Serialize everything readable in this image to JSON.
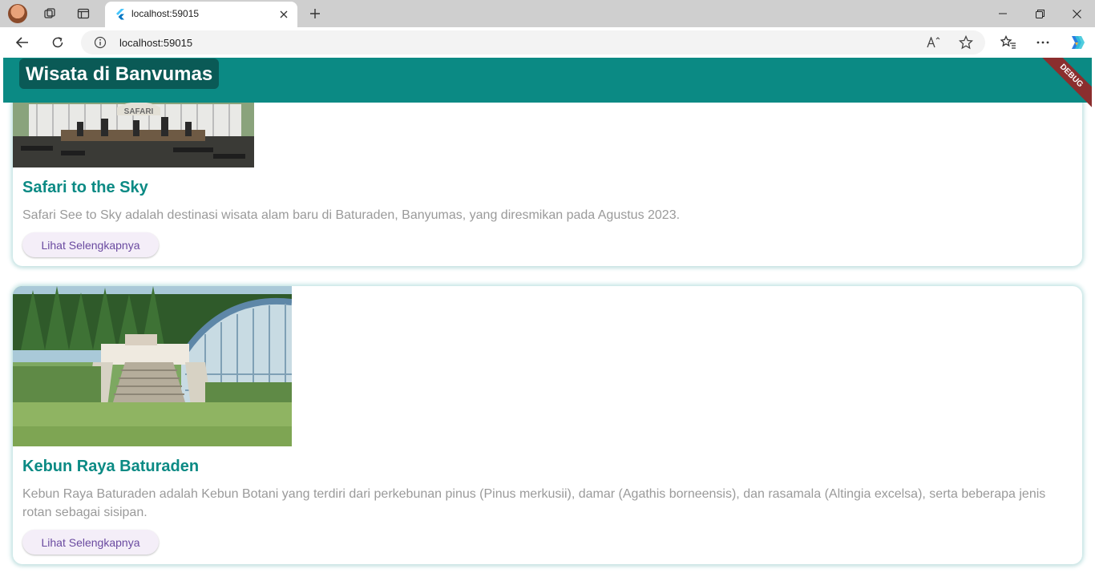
{
  "browser": {
    "tab_title": "localhost:59015",
    "address": "localhost:59015"
  },
  "app": {
    "title": "Wisata di Banvumas",
    "debug_banner": "DEBUG"
  },
  "destinations": [
    {
      "name": "Safari to the Sky",
      "description": "Safari See to Sky adalah destinasi wisata alam baru di Baturaden, Banyumas, yang diresmikan pada Agustus 2023.",
      "button_label": "Lihat Selengkapnya",
      "image_sign": "SAFARI"
    },
    {
      "name": "Kebun Raya Baturaden",
      "description": "Kebun Raya Baturaden adalah Kebun Botani yang terdiri dari perkebunan pinus (Pinus merkusii), damar (Agathis borneensis), dan rasamala (Altingia excelsa), serta beberapa jenis rotan sebagai sisipan.",
      "button_label": "Lihat Selengkapnya"
    }
  ],
  "colors": {
    "appbar": "#0b8a84",
    "title_accent": "#0b8a84",
    "button_text": "#6a4aa0"
  },
  "icons": [
    "profile-avatar",
    "workspaces-icon",
    "tab-actions-icon",
    "flutter-favicon",
    "close-icon",
    "plus-icon",
    "minimize-icon",
    "restore-icon",
    "window-close-icon",
    "back-icon",
    "refresh-icon",
    "info-icon",
    "read-aloud-icon",
    "favorite-star-icon",
    "favorites-icon",
    "more-icon",
    "copilot-icon"
  ]
}
